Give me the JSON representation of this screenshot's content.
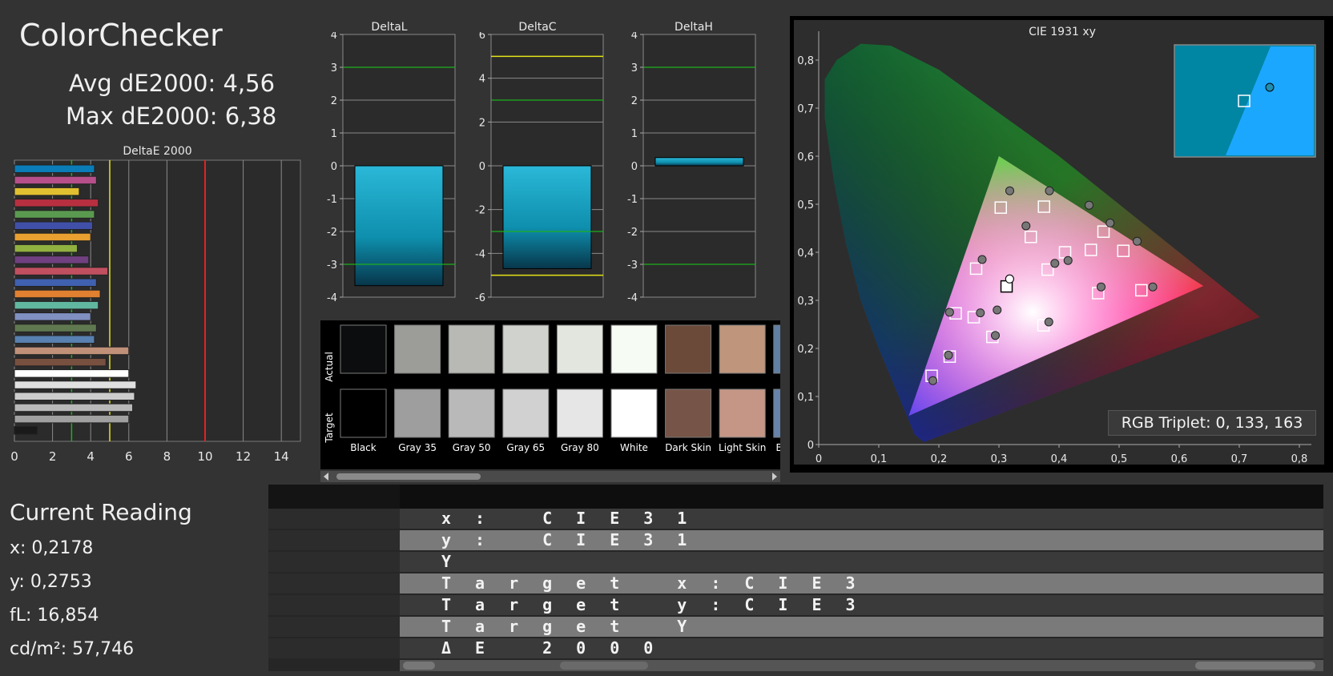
{
  "app": {
    "title": "ColorChecker",
    "avg_label": "Avg dE2000: 4,56",
    "max_label": "Max dE2000: 6,38"
  },
  "deltae_chart": {
    "title": "DeltaE 2000",
    "x_ticks": [
      "0",
      "2",
      "4",
      "6",
      "8",
      "10",
      "12",
      "14"
    ],
    "xlim": [
      0,
      15
    ],
    "threshold_green": 3,
    "threshold_yellow": 5,
    "threshold_red": 10
  },
  "delta_charts": [
    {
      "title": "DeltaL",
      "ticks": [
        "4",
        "3",
        "2",
        "1",
        "0",
        "-1",
        "-2",
        "-3",
        "-4"
      ],
      "ylim": [
        -4,
        4
      ],
      "value": -3.65,
      "green_lines": [
        3,
        -3
      ],
      "yellow_lines": []
    },
    {
      "title": "DeltaC",
      "ticks": [
        "6",
        "4",
        "2",
        "0",
        "-2",
        "-4",
        "-6"
      ],
      "ylim": [
        -6,
        6
      ],
      "value": -4.7,
      "green_lines": [
        3,
        -3
      ],
      "yellow_lines": [
        5,
        -5
      ]
    },
    {
      "title": "DeltaH",
      "ticks": [
        "4",
        "3",
        "2",
        "1",
        "0",
        "-1",
        "-2",
        "-3",
        "-4"
      ],
      "ylim": [
        -4,
        4
      ],
      "value": 0.25,
      "green_lines": [
        3,
        -3
      ],
      "yellow_lines": []
    }
  ],
  "swatches": {
    "row_actual_label": "Actual",
    "row_target_label": "Target",
    "items": [
      {
        "name": "Black",
        "actual": "#0c0d0f",
        "target": "#000000"
      },
      {
        "name": "Gray 35",
        "actual": "#9c9c98",
        "target": "#9e9e9e"
      },
      {
        "name": "Gray 50",
        "actual": "#b8b9b4",
        "target": "#b9b9b9"
      },
      {
        "name": "Gray 65",
        "actual": "#d0d2cd",
        "target": "#d1d1d1"
      },
      {
        "name": "Gray 80",
        "actual": "#e3e6df",
        "target": "#e6e6e6"
      },
      {
        "name": "White",
        "actual": "#f6fbf3",
        "target": "#ffffff"
      },
      {
        "name": "Dark Skin",
        "actual": "#6b4a3a",
        "target": "#765447"
      },
      {
        "name": "Light Skin",
        "actual": "#bf957b",
        "target": "#c59685"
      },
      {
        "name": "Blue Sky",
        "actual": "#5f7fa5",
        "target": "#6583ab"
      }
    ]
  },
  "cie_chart": {
    "title": "CIE 1931 xy",
    "x_ticks": [
      "0",
      "0,1",
      "0,2",
      "0,3",
      "0,4",
      "0,5",
      "0,6",
      "0,7",
      "0,8"
    ],
    "y_ticks": [
      "0",
      "0,1",
      "0,2",
      "0,3",
      "0,4",
      "0,5",
      "0,6",
      "0,7",
      "0,8"
    ],
    "triangle": [
      [
        0.64,
        0.33
      ],
      [
        0.3,
        0.6
      ],
      [
        0.15,
        0.06
      ]
    ],
    "targets": [
      [
        0.3127,
        0.329
      ],
      [
        0.453,
        0.405
      ],
      [
        0.507,
        0.403
      ],
      [
        0.465,
        0.315
      ],
      [
        0.537,
        0.321
      ],
      [
        0.375,
        0.495
      ],
      [
        0.303,
        0.493
      ],
      [
        0.262,
        0.366
      ],
      [
        0.228,
        0.273
      ],
      [
        0.218,
        0.183
      ],
      [
        0.188,
        0.143
      ],
      [
        0.258,
        0.265
      ],
      [
        0.289,
        0.224
      ],
      [
        0.374,
        0.248
      ],
      [
        0.381,
        0.364
      ],
      [
        0.353,
        0.432
      ],
      [
        0.474,
        0.443
      ],
      [
        0.41,
        0.4
      ]
    ],
    "actuals": [
      [
        0.3178,
        0.3445
      ],
      [
        0.47,
        0.328
      ],
      [
        0.556,
        0.328
      ],
      [
        0.485,
        0.461
      ],
      [
        0.53,
        0.423
      ],
      [
        0.384,
        0.528
      ],
      [
        0.318,
        0.528
      ],
      [
        0.272,
        0.385
      ],
      [
        0.2178,
        0.2753
      ],
      [
        0.216,
        0.186
      ],
      [
        0.19,
        0.133
      ],
      [
        0.269,
        0.274
      ],
      [
        0.294,
        0.227
      ],
      [
        0.383,
        0.255
      ],
      [
        0.393,
        0.377
      ],
      [
        0.345,
        0.455
      ],
      [
        0.45,
        0.498
      ],
      [
        0.415,
        0.383
      ],
      [
        0.297,
        0.28
      ]
    ],
    "rgb_triplet_label": "RGB Triplet: 0, 133, 163",
    "inset_color": "#0085a3"
  },
  "current_reading": {
    "title": "Current Reading",
    "x": "x: 0,2178",
    "y": "y: 0,2753",
    "fl": "fL: 16,854",
    "cdm2": "cd/m²: 57,746"
  },
  "grid_rows": [
    "x: CIE31",
    "y: CIE31",
    "Y",
    "Target x:CIE3",
    "Target y:CIE3",
    "Target Y",
    "ΔE 2000"
  ]
}
